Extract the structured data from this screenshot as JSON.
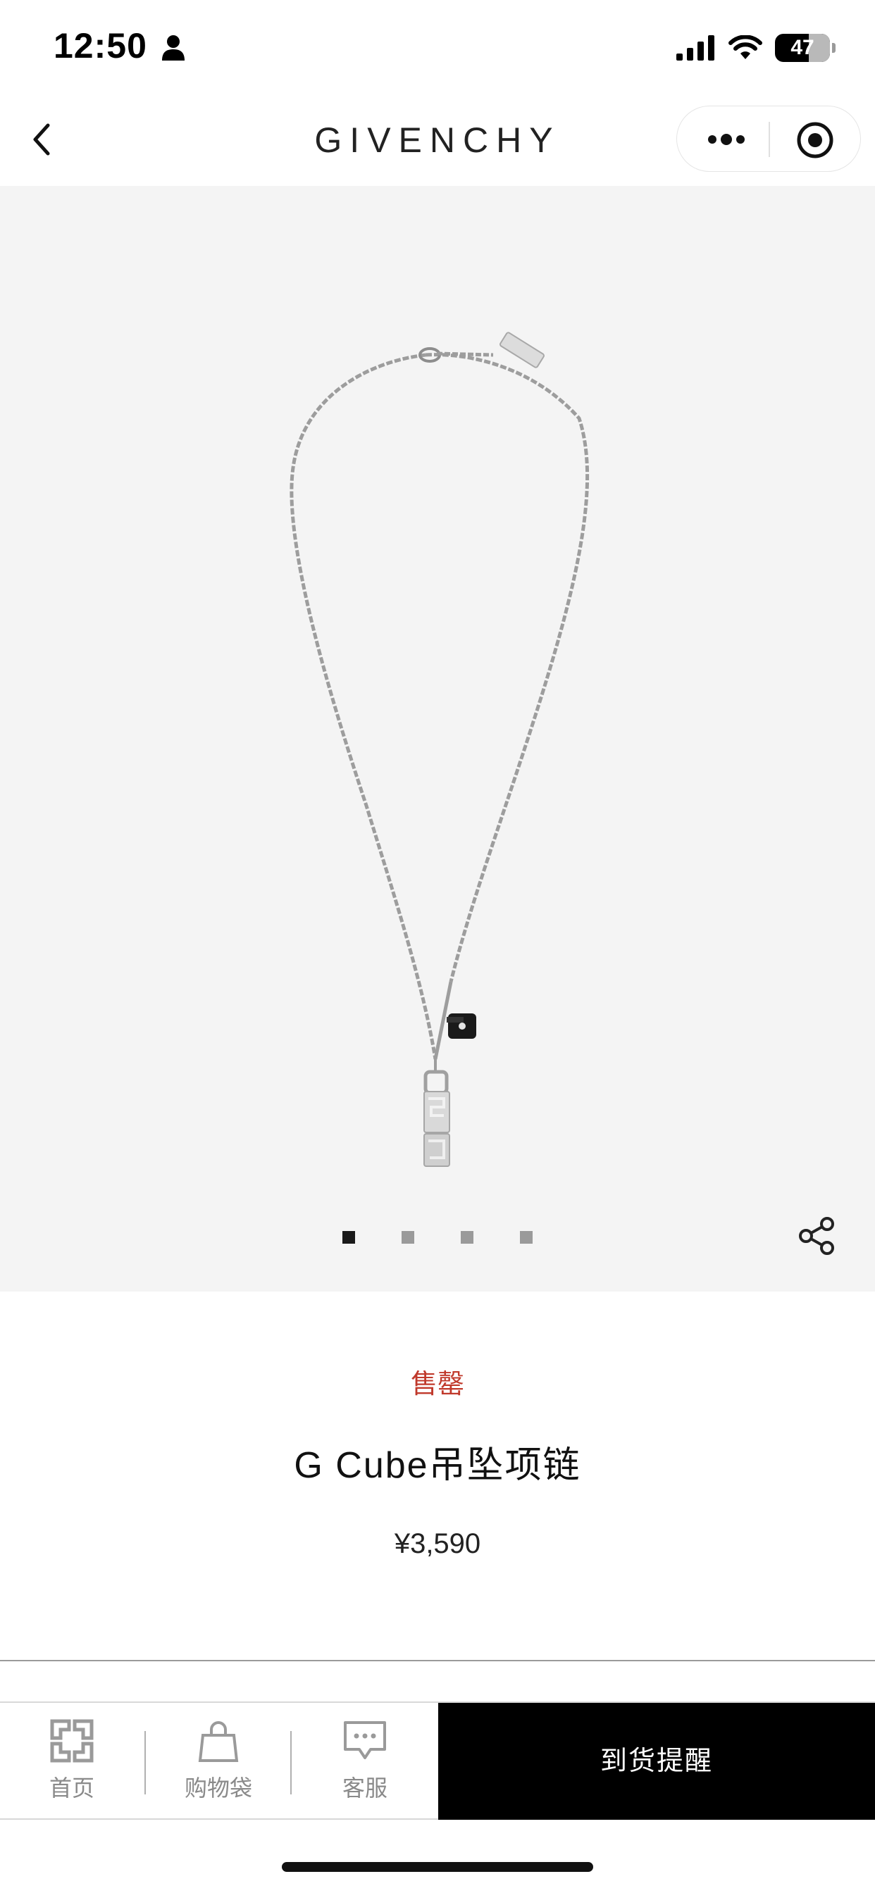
{
  "status_bar": {
    "time": "12:50",
    "battery": "47"
  },
  "nav": {
    "brand": "GIVENCHY"
  },
  "gallery": {
    "image_count": 4,
    "active_index": 0
  },
  "product": {
    "status": "售罄",
    "name": "G Cube吊坠项链",
    "price": "¥3,590"
  },
  "tabbar": {
    "home_label": "首页",
    "bag_label": "购物袋",
    "service_label": "客服",
    "notify_label": "到货提醒"
  },
  "colors": {
    "accent_red": "#c0392b",
    "gallery_bg": "#f4f4f4",
    "cta_bg": "#000000"
  }
}
